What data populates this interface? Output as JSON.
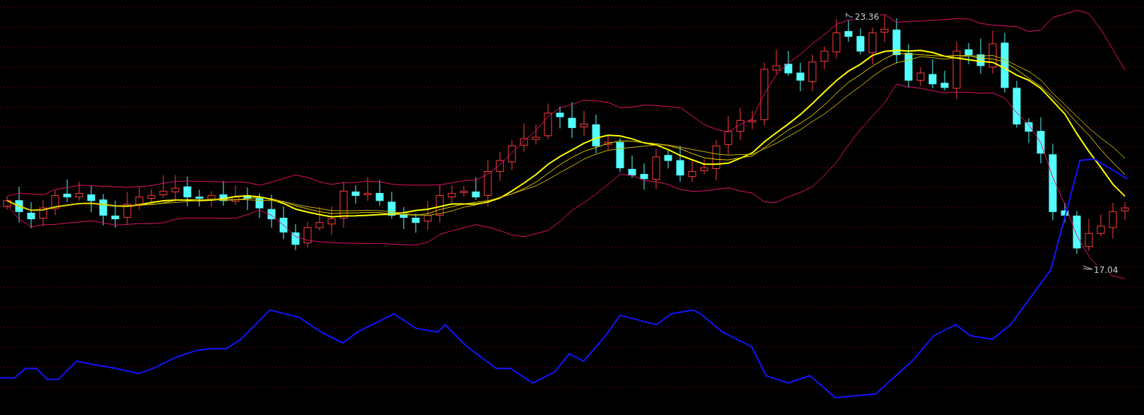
{
  "chart": {
    "high_label": "23.36",
    "low_label": "17.04"
  }
}
